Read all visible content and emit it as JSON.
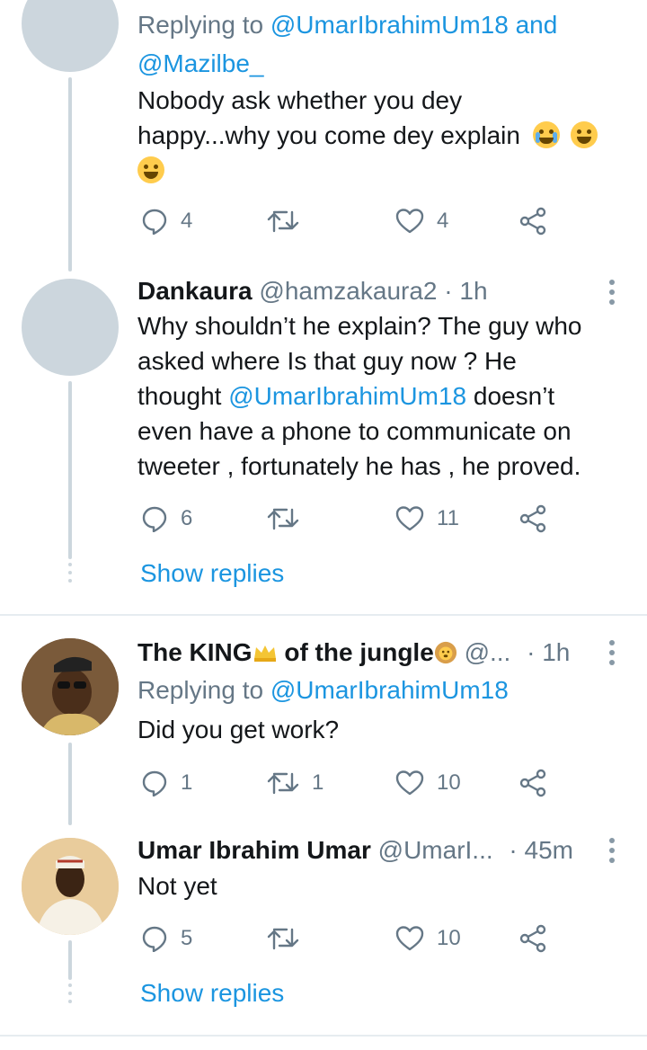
{
  "tweets": [
    {
      "replying_prefix": "Replying to",
      "replying_handles": "@UmarIbrahimUm18",
      "replying_and": "and",
      "replying_handle2": "@Mazilbe_",
      "body_line1": "Nobody ask whether you dey",
      "body_line2": "happy...why you come dey explain",
      "reply_count": "4",
      "retweet_count": "",
      "like_count": "4"
    },
    {
      "display_name": "Dankaura",
      "handle": "@hamzakaura2",
      "time": "· 1h",
      "body_line1": "Why shouldn’t he explain? The guy who",
      "body_line2": "asked where Is that guy now ? He",
      "body_line3a": "thought",
      "body_line3_mention": "@UmarIbrahimUm18",
      "body_line3b": "doesn’t",
      "body_line4": "even have a phone to communicate on",
      "body_line5": "tweeter , fortunately he has , he proved.",
      "reply_count": "6",
      "retweet_count": "",
      "like_count": "11",
      "show_replies": "Show replies"
    },
    {
      "display_name_a": "The KING",
      "display_name_b": " of the jungle",
      "handle": "@...",
      "time": "· 1h",
      "replying_prefix": "Replying to",
      "replying_handles": "@UmarIbrahimUm18",
      "body": "Did you get work?",
      "reply_count": "1",
      "retweet_count": "1",
      "like_count": "10"
    },
    {
      "display_name": "Umar Ibrahim Umar",
      "handle": "@UmarI...",
      "time": "· 45m",
      "body": "Not yet",
      "reply_count": "5",
      "retweet_count": "",
      "like_count": "10",
      "show_replies": "Show replies"
    }
  ],
  "icons": {
    "reply": "reply-icon",
    "retweet": "retweet-icon",
    "like": "heart-icon",
    "share": "share-icon",
    "more": "more-vertical-icon"
  },
  "colors": {
    "link": "#1b95e0",
    "secondary_text": "#657786",
    "thread_line": "#ccd6dd"
  }
}
